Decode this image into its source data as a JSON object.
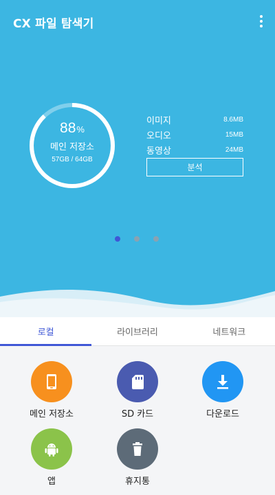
{
  "header": {
    "title": "CX 파일 탐색기",
    "menu_icon": "more-vert-icon"
  },
  "storage": {
    "percent": "88",
    "percent_unit": "%",
    "label": "메인 저장소",
    "size": "57GB / 64GB",
    "used_fraction": 0.88
  },
  "stats": [
    {
      "label": "이미지",
      "value": "8.6MB"
    },
    {
      "label": "오디오",
      "value": "15MB"
    },
    {
      "label": "동영상",
      "value": "24MB"
    }
  ],
  "analyze_label": "분석",
  "pager": {
    "count": 3,
    "active": 0
  },
  "tabs": [
    {
      "label": "로컬",
      "active": true
    },
    {
      "label": "라이브러리",
      "active": false
    },
    {
      "label": "네트워크",
      "active": false
    }
  ],
  "items": [
    {
      "label": "메인 저장소",
      "icon": "phone-icon",
      "color": "#f7901e"
    },
    {
      "label": "SD 카드",
      "icon": "sd-card-icon",
      "color": "#4a5bb0"
    },
    {
      "label": "다운로드",
      "icon": "download-icon",
      "color": "#2196f3"
    },
    {
      "label": "앱",
      "icon": "android-icon",
      "color": "#8bc34a"
    },
    {
      "label": "휴지통",
      "icon": "trash-icon",
      "color": "#5d6b78"
    }
  ],
  "colors": {
    "hero_bg": "#3cb6e2",
    "accent": "#3f57d6"
  }
}
